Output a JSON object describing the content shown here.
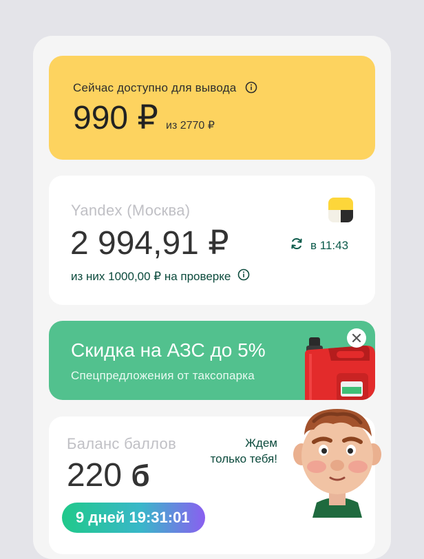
{
  "withdraw": {
    "label": "Сейчас доступно для вывода",
    "amount": "990 ₽",
    "total": "из 2770 ₽"
  },
  "balance": {
    "account": "Yandex (Москва)",
    "amount": "2 994,91 ₽",
    "sync_time": "в 11:43",
    "pending": "из них 1000,00 ₽ на проверке"
  },
  "promo": {
    "title": "Скидка на АЗС до 5%",
    "subtitle": "Спецпредложения от таксопарка"
  },
  "points": {
    "label": "Баланс баллов",
    "amount": "220",
    "currency_glyph": "б",
    "message": "Ждем только тебя!",
    "timer": "9 дней 19:31:01"
  },
  "colors": {
    "withdraw_bg": "#fdd35f",
    "promo_bg": "#52c18e",
    "accent_text": "#0b4a3c"
  },
  "icons": [
    "info-icon",
    "refresh-icon",
    "yandex-logo",
    "close-icon",
    "fuel-canister-image",
    "character-illustration"
  ]
}
